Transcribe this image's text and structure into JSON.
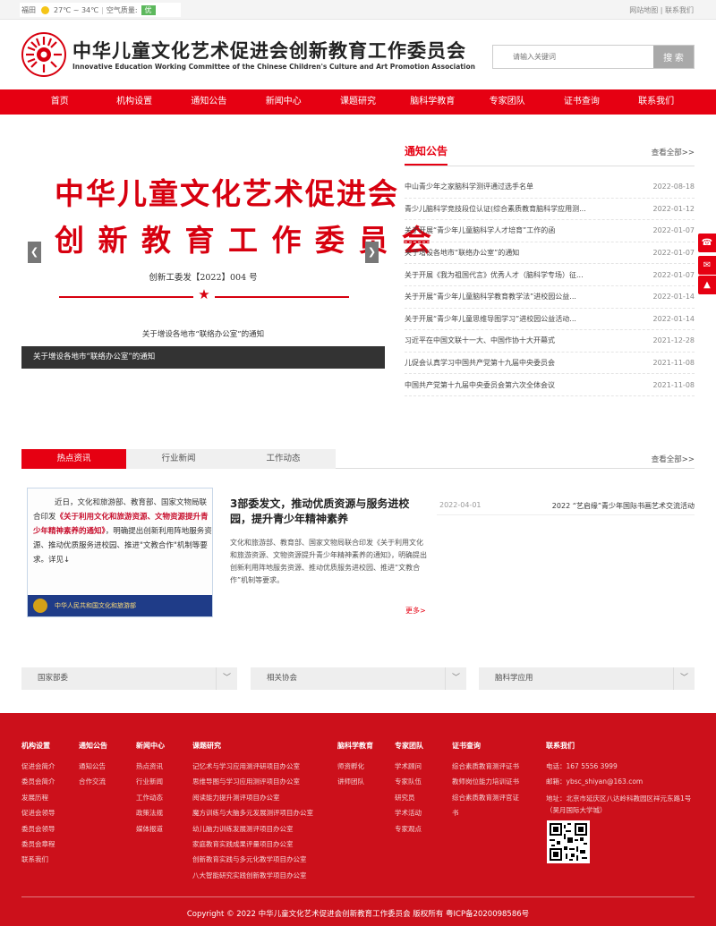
{
  "topbar": {
    "city": "福田",
    "temperature": "27℃ ~ 34℃",
    "air_label": "空气质量:",
    "air_quality": "优",
    "sitemap": "网站地图",
    "divider": "|",
    "contact": "联系我们"
  },
  "header": {
    "title_cn": "中华儿童文化艺术促进会创新教育工作委员会",
    "title_en": "Innovative Education Working Committee of the Chinese Children's Culture and Art Promotion Association"
  },
  "search": {
    "placeholder": "请输入关键词",
    "button": "搜 索"
  },
  "nav": [
    "首页",
    "机构设置",
    "通知公告",
    "新闻中心",
    "课题研究",
    "脑科学教育",
    "专家团队",
    "证书查询",
    "联系我们"
  ],
  "banner": {
    "title_line1": "中华儿童文化艺术促进会",
    "title_line2": "创 新 教 育 工 作 委 员 会",
    "doc_no": "创新工委发【2022】004 号",
    "star": "★",
    "subtitle": "关于增设各地市“联络办公室”的通知",
    "caption": "关于增设各地市“联络办公室”的通知",
    "prev": "❮",
    "next": "❯"
  },
  "notice": {
    "title": "通知公告",
    "more": "查看全部>>",
    "items": [
      {
        "title": "中山青少年之家脑科学测评通过选手名单",
        "date": "2022-08-18"
      },
      {
        "title": "青少儿脑科学竞技段位认证(综合素质教育脑科学应用测...",
        "date": "2022-01-12"
      },
      {
        "title": "关于开展“青少年儿童脑科学人才培育”工作的函",
        "date": "2022-01-07"
      },
      {
        "title": "关于增设各地市“联络办公室”的通知",
        "date": "2022-01-07"
      },
      {
        "title": "关于开展《我为祖国代言》优秀人才（脑科学专场）征...",
        "date": "2022-01-07"
      },
      {
        "title": "关于开展“青少年儿童脑科学教育教学法”进校园公益...",
        "date": "2022-01-14"
      },
      {
        "title": "关于开展“青少年儿童思维导图学习”进校园公益活动...",
        "date": "2022-01-14"
      },
      {
        "title": "习近平在中国文联十一大、中国作协十大开幕式",
        "date": "2021-12-28"
      },
      {
        "title": "儿促会认真学习中国共产党第十九届中央委员会",
        "date": "2021-11-08"
      },
      {
        "title": "中国共产党第十九届中央委员会第六次全体会议",
        "date": "2021-11-08"
      }
    ]
  },
  "float_buttons": [
    "☎",
    "✉",
    "▲"
  ],
  "news": {
    "tabs": [
      "热点资讯",
      "行业新闻",
      "工作动态"
    ],
    "more": "查看全部>>",
    "image_text_pre": "近日，文化和旅游部、教育部、国家文物局联合印发",
    "image_text_highlight": "《关于利用文化和旅游资源、文物资源提升青少年精神素养的通知》",
    "image_text_post": "，明确提出创新利用阵地服务资源、推动优质服务进校园、推进\"文教合作\"机制等要求。详见↓",
    "image_footer": "中华人民共和国文化和旅游部",
    "headline": "3部委发文，推动优质资源与服务进校园，提升青少年精神素养",
    "summary": "文化和旅游部、教育部、国家文物局联合印发《关于利用文化和旅游资源、文物资源提升青少年精神素养的通知》，明确提出创新利用阵地服务资源、推动优质服务进校园、推进“文教合作”机制等要求。",
    "read_more": "更多>",
    "side_item": {
      "date": "2022-04-01",
      "title": "2022 “艺启缘”青少年国际书画艺术交流活动"
    }
  },
  "links": {
    "selects": [
      "国家部委",
      "相关协会",
      "脑科学应用"
    ],
    "chevron": "﹀"
  },
  "footer": {
    "columns": [
      {
        "title": "机构设置",
        "items": [
          "促进会简介",
          "委员会简介",
          "发展历程",
          "促进会领导",
          "委员会领导",
          "委员会章程",
          "联系我们"
        ]
      },
      {
        "title": "通知公告",
        "items": [
          "通知公告",
          "合作交流"
        ]
      },
      {
        "title": "新闻中心",
        "items": [
          "热点资讯",
          "行业新闻",
          "工作动态",
          "政策法规",
          "媒体报道"
        ]
      },
      {
        "title": "课题研究",
        "items": [
          "记忆术与学习应用测评研项目办公室",
          "思维导图与学习应用测评项目办公室",
          "阅读能力提升测评项目办公室",
          "魔方训练与大脑多元发展测评项目办公室",
          "幼儿脑力训练发展测评项目办公室",
          "家庭教育实践成果评量项目办公室",
          "创新教育实践与多元化教学项目办公室",
          "八大智能研究实践创新教学项目办公室"
        ]
      },
      {
        "title": "脑科学教育",
        "items": [
          "师资孵化",
          "讲师团队"
        ]
      },
      {
        "title": "专家团队",
        "items": [
          "学术顾问",
          "专家队伍",
          "研究员",
          "学术活动",
          "专家观点"
        ]
      },
      {
        "title": "证书查询",
        "items": [
          "综合素质教育测评证书",
          "教师岗位能力培训证书",
          "综合素质教育测评官证书"
        ]
      },
      {
        "title": "联系我们",
        "items": [
          "电话：167 5556 3999",
          "邮箱：ybsc_shiyan@163.com",
          "地址：北京市延庆区八达岭科教园区祥元东路1号（昊月国际大学城）"
        ]
      }
    ],
    "copyright": "Copyright © 2022 中华儿童文化艺术促进会创新教育工作委员会 版权所有 粤ICP备2020098586号"
  },
  "colors": {
    "brand_red": "#e60012",
    "footer_red": "#cc101b",
    "banner_red": "#d7000f"
  }
}
